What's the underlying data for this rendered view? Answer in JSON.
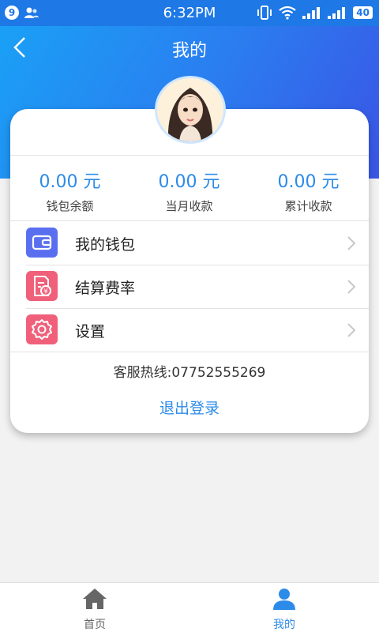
{
  "status_bar": {
    "notification_count": "9",
    "time": "6:32PM",
    "battery": "40"
  },
  "header": {
    "title": "我的",
    "back_icon": "chevron-left-icon"
  },
  "stats": [
    {
      "value": "0.00 元",
      "label": "钱包余额"
    },
    {
      "value": "0.00 元",
      "label": "当月收款"
    },
    {
      "value": "0.00 元",
      "label": "累计收款"
    }
  ],
  "menu": [
    {
      "label": "我的钱包",
      "icon": "wallet-icon",
      "color": "#5a6ff0"
    },
    {
      "label": "结算费率",
      "icon": "invoice-icon",
      "color": "#f0607a"
    },
    {
      "label": "设置",
      "icon": "gear-icon",
      "color": "#f0607a"
    }
  ],
  "hotline": "客服热线:07752555269",
  "logout_label": "退出登录",
  "tabs": [
    {
      "label": "首页",
      "icon": "home-icon",
      "color": "#666666"
    },
    {
      "label": "我的",
      "icon": "user-icon",
      "color": "#2c8be8"
    }
  ],
  "colors": {
    "accent": "#2c8be8",
    "header_gradient_start": "#1aa0f6",
    "header_gradient_end": "#3a55e6"
  }
}
